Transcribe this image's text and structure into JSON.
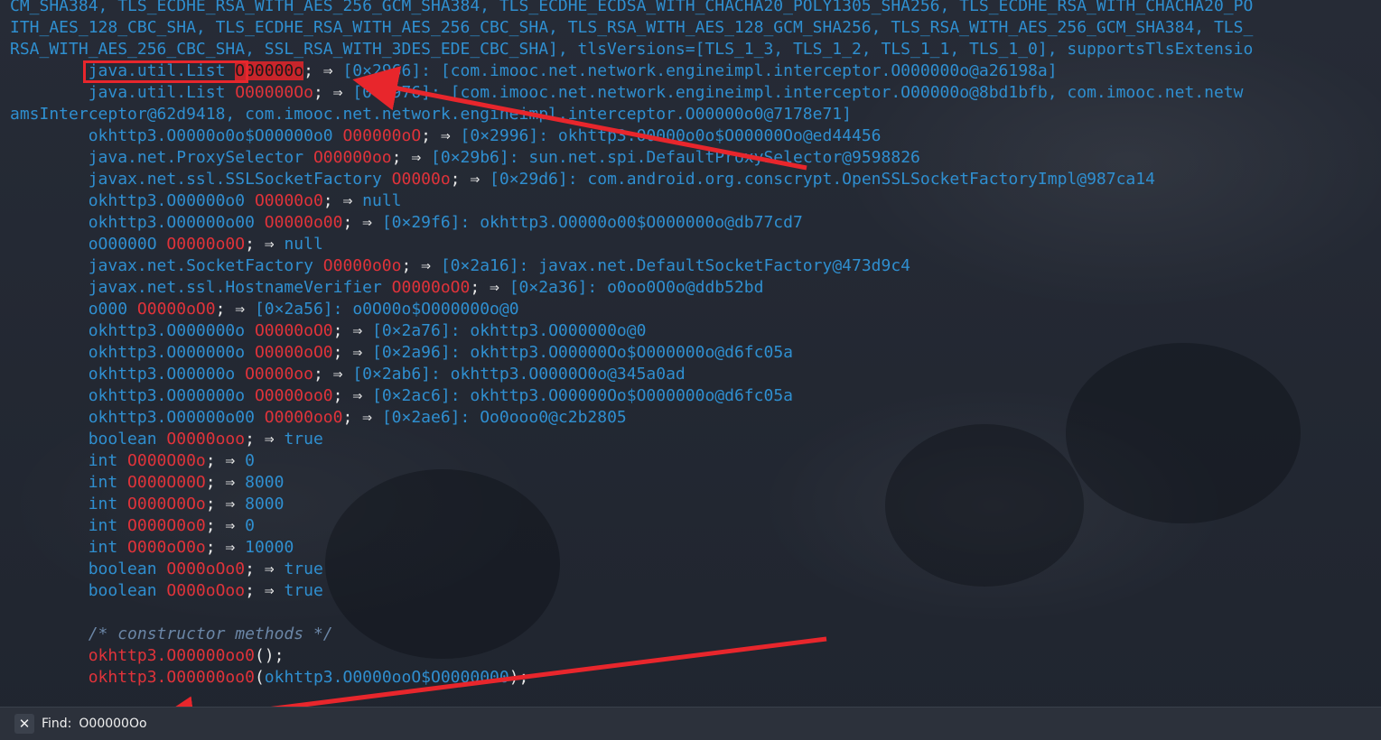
{
  "lines": [
    {
      "parts": [
        {
          "c": "t",
          "v": "CM_SHA384, TLS_ECDHE_RSA_WITH_AES_256_GCM_SHA384, TLS_ECDHE_ECDSA_WITH_CHACHA20_POLY1305_SHA256, TLS_ECDHE_RSA_WITH_CHACHA20_PO"
        }
      ]
    },
    {
      "parts": [
        {
          "c": "t",
          "v": "ITH_AES_128_CBC_SHA, TLS_ECDHE_RSA_WITH_AES_256_CBC_SHA, TLS_RSA_WITH_AES_128_GCM_SHA256, TLS_RSA_WITH_AES_256_GCM_SHA384, TLS_"
        }
      ]
    },
    {
      "parts": [
        {
          "c": "t",
          "v": "RSA_WITH_AES_256_CBC_SHA, SSL_RSA_WITH_3DES_EDE_CBC_SHA], tlsVersions=[TLS_1_3, TLS_1_2, TLS_1_1, TLS_1_0], supportsTlsExtensio"
        }
      ]
    },
    {
      "parts": [
        {
          "c": "t",
          "v": "        java.util.List "
        },
        {
          "c": "hl",
          "v": "O00000o"
        },
        {
          "c": "p",
          "v": "; ⇒ "
        },
        {
          "c": "t",
          "v": "[0×2966]: [com.imooc.net.network.engineimpl.interceptor.O000000o@a26198a]"
        }
      ]
    },
    {
      "parts": [
        {
          "c": "t",
          "v": "        java.util.List "
        },
        {
          "c": "f",
          "v": "O00000Oo"
        },
        {
          "c": "p",
          "v": "; ⇒ "
        },
        {
          "c": "t",
          "v": "[0×2976]: [com.imooc.net.network.engineimpl.interceptor.O00000o@8bd1bfb, com.imooc.net.netw"
        }
      ]
    },
    {
      "parts": [
        {
          "c": "t",
          "v": "amsInterceptor@62d9418, com.imooc.net.network.engineimpl.interceptor.O00000o0@7178e71]"
        }
      ]
    },
    {
      "parts": [
        {
          "c": "t",
          "v": "        okhttp3.O0000o0o$O00000o0 "
        },
        {
          "c": "f",
          "v": "O00000oO"
        },
        {
          "c": "p",
          "v": "; ⇒ "
        },
        {
          "c": "t",
          "v": "[0×2996]: okhttp3.O0000o0o$O00000Oo@ed44456"
        }
      ]
    },
    {
      "parts": [
        {
          "c": "t",
          "v": "        java.net.ProxySelector "
        },
        {
          "c": "f",
          "v": "O00000oo"
        },
        {
          "c": "p",
          "v": "; ⇒ "
        },
        {
          "c": "t",
          "v": "[0×29b6]: sun.net.spi.DefaultProxySelector@9598826"
        }
      ]
    },
    {
      "parts": [
        {
          "c": "t",
          "v": "        javax.net.ssl.SSLSocketFactory "
        },
        {
          "c": "f",
          "v": "O0000o"
        },
        {
          "c": "p",
          "v": "; ⇒ "
        },
        {
          "c": "t",
          "v": "[0×29d6]: com.android.org.conscrypt.OpenSSLSocketFactoryImpl@987ca14"
        }
      ]
    },
    {
      "parts": [
        {
          "c": "t",
          "v": "        okhttp3.O00000o0 "
        },
        {
          "c": "f",
          "v": "O0000o0"
        },
        {
          "c": "p",
          "v": "; ⇒ "
        },
        {
          "c": "t",
          "v": "null"
        }
      ]
    },
    {
      "parts": [
        {
          "c": "t",
          "v": "        okhttp3.O00000o00 "
        },
        {
          "c": "f",
          "v": "O0000o00"
        },
        {
          "c": "p",
          "v": "; ⇒ "
        },
        {
          "c": "t",
          "v": "[0×29f6]: okhttp3.O0000o00$O000000o@db77cd7"
        }
      ]
    },
    {
      "parts": [
        {
          "c": "t",
          "v": "        oO0000O "
        },
        {
          "c": "f",
          "v": "O0000o0O"
        },
        {
          "c": "p",
          "v": "; ⇒ "
        },
        {
          "c": "t",
          "v": "null"
        }
      ]
    },
    {
      "parts": [
        {
          "c": "t",
          "v": "        javax.net.SocketFactory "
        },
        {
          "c": "f",
          "v": "O0000o0o"
        },
        {
          "c": "p",
          "v": "; ⇒ "
        },
        {
          "c": "t",
          "v": "[0×2a16]: javax.net.DefaultSocketFactory@473d9c4"
        }
      ]
    },
    {
      "parts": [
        {
          "c": "t",
          "v": "        javax.net.ssl.HostnameVerifier "
        },
        {
          "c": "f",
          "v": "O0000oO0"
        },
        {
          "c": "p",
          "v": "; ⇒ "
        },
        {
          "c": "t",
          "v": "[0×2a36]: o0oo0O0o@ddb52bd"
        }
      ]
    },
    {
      "parts": [
        {
          "c": "t",
          "v": "        o000 "
        },
        {
          "c": "f",
          "v": "O0000oO0"
        },
        {
          "c": "p",
          "v": "; ⇒ "
        },
        {
          "c": "t",
          "v": "[0×2a56]: o0O00o$O000000o@0"
        }
      ]
    },
    {
      "parts": [
        {
          "c": "t",
          "v": "        okhttp3.O000000o "
        },
        {
          "c": "f",
          "v": "O0000oO0"
        },
        {
          "c": "p",
          "v": "; ⇒ "
        },
        {
          "c": "t",
          "v": "[0×2a76]: okhttp3.O000000o@0"
        }
      ]
    },
    {
      "parts": [
        {
          "c": "t",
          "v": "        okhttp3.O000000o "
        },
        {
          "c": "f",
          "v": "O0000oO0"
        },
        {
          "c": "p",
          "v": "; ⇒ "
        },
        {
          "c": "t",
          "v": "[0×2a96]: okhttp3.O00000Oo$O000000o@d6fc05a"
        }
      ]
    },
    {
      "parts": [
        {
          "c": "t",
          "v": "        okhttp3.O00000o "
        },
        {
          "c": "f",
          "v": "O0000oo"
        },
        {
          "c": "p",
          "v": "; ⇒ "
        },
        {
          "c": "t",
          "v": "[0×2ab6]: okhttp3.O0000O0o@345a0ad"
        }
      ]
    },
    {
      "parts": [
        {
          "c": "t",
          "v": "        okhttp3.O000000o "
        },
        {
          "c": "f",
          "v": "O0000oo0"
        },
        {
          "c": "p",
          "v": "; ⇒ "
        },
        {
          "c": "t",
          "v": "[0×2ac6]: okhttp3.O00000Oo$O000000o@d6fc05a"
        }
      ]
    },
    {
      "parts": [
        {
          "c": "t",
          "v": "        okhttp3.O00000o00 "
        },
        {
          "c": "f",
          "v": "O0000oo0"
        },
        {
          "c": "p",
          "v": "; ⇒ "
        },
        {
          "c": "t",
          "v": "[0×2ae6]: Oo0ooo0@c2b2805"
        }
      ]
    },
    {
      "parts": [
        {
          "c": "t",
          "v": "        boolean "
        },
        {
          "c": "f",
          "v": "O0000ooo"
        },
        {
          "c": "p",
          "v": "; ⇒ "
        },
        {
          "c": "t",
          "v": "true"
        }
      ]
    },
    {
      "parts": [
        {
          "c": "t",
          "v": "        int "
        },
        {
          "c": "f",
          "v": "O000O00o"
        },
        {
          "c": "p",
          "v": "; ⇒ "
        },
        {
          "c": "t",
          "v": "0"
        }
      ]
    },
    {
      "parts": [
        {
          "c": "t",
          "v": "        int "
        },
        {
          "c": "f",
          "v": "O000O00O"
        },
        {
          "c": "p",
          "v": "; ⇒ "
        },
        {
          "c": "t",
          "v": "8000"
        }
      ]
    },
    {
      "parts": [
        {
          "c": "t",
          "v": "        int "
        },
        {
          "c": "f",
          "v": "O000O0Oo"
        },
        {
          "c": "p",
          "v": "; ⇒ "
        },
        {
          "c": "t",
          "v": "8000"
        }
      ]
    },
    {
      "parts": [
        {
          "c": "t",
          "v": "        int "
        },
        {
          "c": "f",
          "v": "O000O0o0"
        },
        {
          "c": "p",
          "v": "; ⇒ "
        },
        {
          "c": "t",
          "v": "0"
        }
      ]
    },
    {
      "parts": [
        {
          "c": "t",
          "v": "        int "
        },
        {
          "c": "f",
          "v": "O000oO0o"
        },
        {
          "c": "p",
          "v": "; ⇒ "
        },
        {
          "c": "t",
          "v": "10000"
        }
      ]
    },
    {
      "parts": [
        {
          "c": "t",
          "v": "        boolean "
        },
        {
          "c": "f",
          "v": "O000oOo0"
        },
        {
          "c": "p",
          "v": "; ⇒ "
        },
        {
          "c": "t",
          "v": "true"
        }
      ]
    },
    {
      "parts": [
        {
          "c": "t",
          "v": "        boolean "
        },
        {
          "c": "f",
          "v": "O000oOoo"
        },
        {
          "c": "p",
          "v": "; ⇒ "
        },
        {
          "c": "t",
          "v": "true"
        }
      ]
    },
    {
      "parts": []
    },
    {
      "parts": [
        {
          "c": "c",
          "v": "        /* constructor methods */"
        }
      ]
    },
    {
      "parts": [
        {
          "c": "m",
          "v": "        okhttp3.O00000oo0"
        },
        {
          "c": "p",
          "v": "();"
        }
      ]
    },
    {
      "parts": [
        {
          "c": "m",
          "v": "        okhttp3.O00000oo0"
        },
        {
          "c": "p",
          "v": "("
        },
        {
          "c": "t",
          "v": "okhttp3.O0000ooO$O0000000"
        },
        {
          "c": "p",
          "v": ");"
        }
      ]
    }
  ],
  "findbar": {
    "close_icon": "close-icon",
    "label": "Find:",
    "query": "O00000Oo"
  },
  "annotations": {
    "color": "#e8262c",
    "box_target": "java.util.List"
  }
}
